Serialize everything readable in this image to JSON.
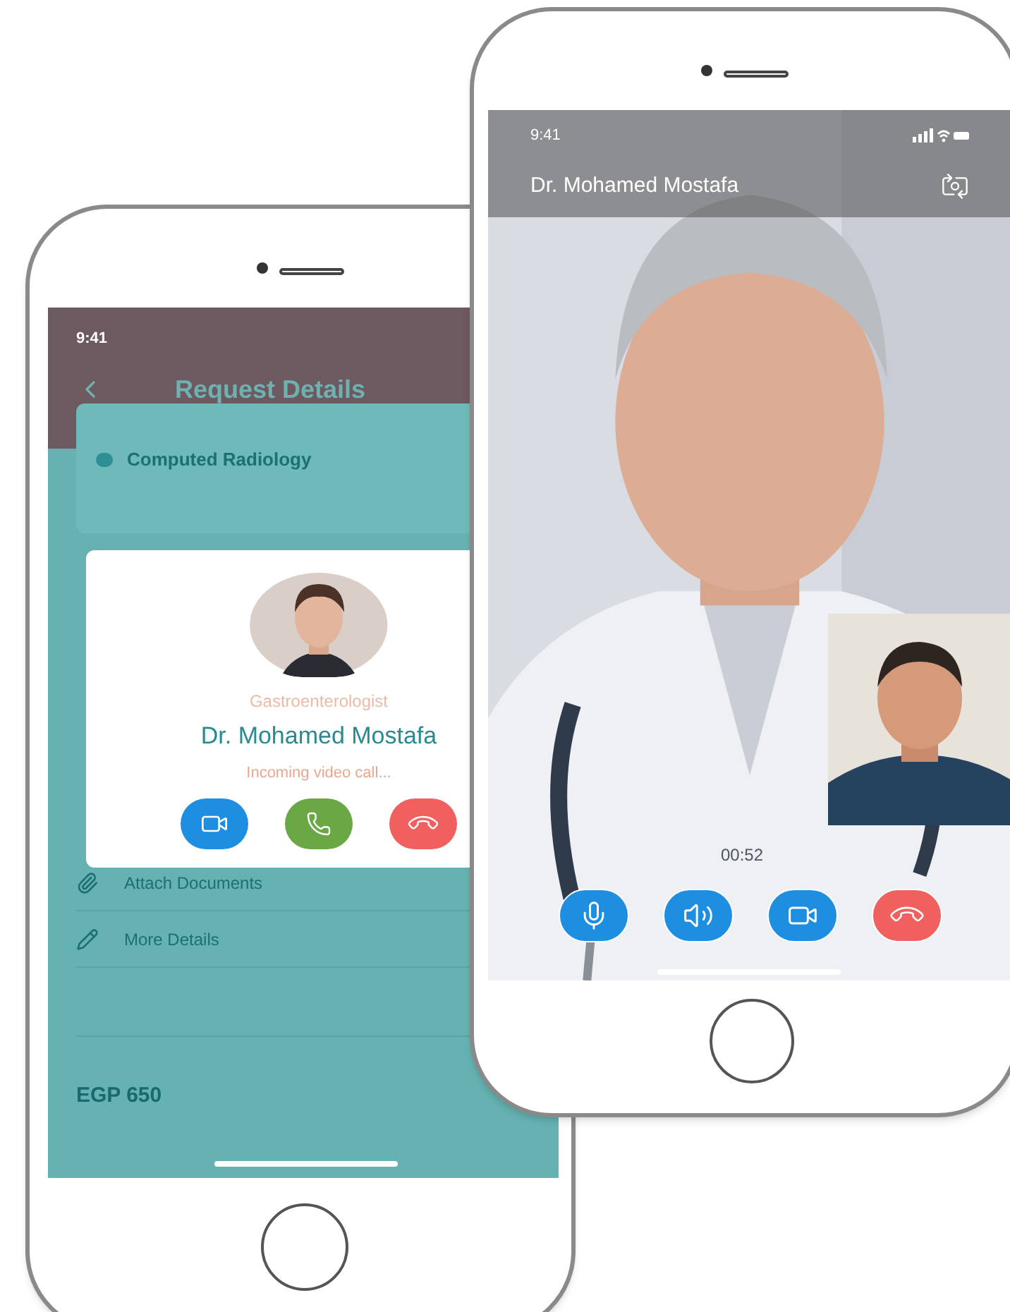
{
  "left_phone": {
    "status_bar": {
      "time": "9:41"
    },
    "header": {
      "title": "Request Details"
    },
    "request_card": {
      "service": "Computed Radiology"
    },
    "incoming_call": {
      "specialty": "Gastroenterologist",
      "doctor": "Dr. Mohamed Mostafa",
      "status": "Incoming video call...",
      "buttons": [
        {
          "kind": "video"
        },
        {
          "kind": "voice"
        },
        {
          "kind": "decline"
        }
      ]
    },
    "rows": [
      {
        "kind": "attach",
        "label": "Attach Documents"
      },
      {
        "kind": "edit",
        "label": "More Details"
      }
    ],
    "total": {
      "amount": "EGP 650"
    }
  },
  "right_phone": {
    "status_bar": {
      "time": "9:41"
    },
    "caller": "Dr. Mohamed Mostafa",
    "timer": "00:52",
    "controls": [
      {
        "kind": "mic"
      },
      {
        "kind": "speaker"
      },
      {
        "kind": "video"
      },
      {
        "kind": "end"
      }
    ]
  }
}
